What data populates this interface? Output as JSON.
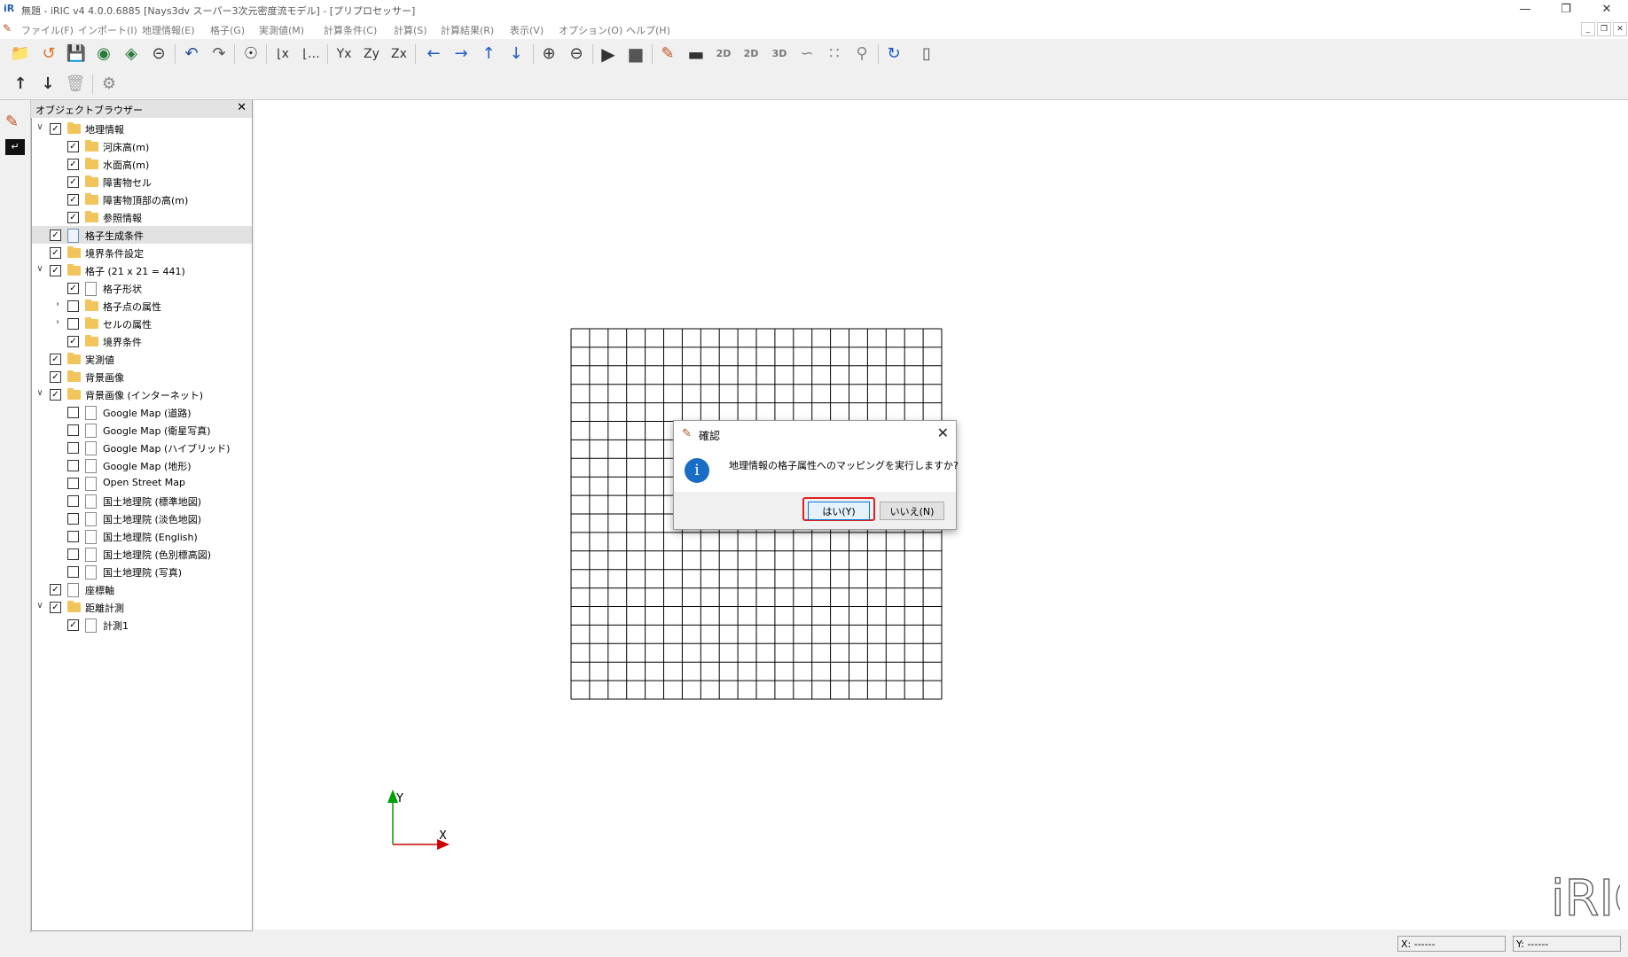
{
  "window": {
    "title": "無題 - iRIC v4 4.0.0.6885 [Nays3dv スーパー3次元密度流モデル] - [プリプロセッサー]",
    "app_icon": "iR",
    "controls": [
      "minimize-icon",
      "restore-icon",
      "close-icon"
    ]
  },
  "menu": {
    "items": [
      "ファイル(F)",
      "インポート(I)",
      "地理情報(E)",
      "格子(G)",
      "実測値(M)",
      "計算条件(C)",
      "計算(S)",
      "計算結果(R)",
      "表示(V)",
      "オプション(O)",
      "ヘルプ(H)"
    ]
  },
  "toolbar": {
    "icons": [
      "open-folder-icon",
      "open-project-icon",
      "save-icon",
      "snapshot-icon",
      "continuous-snapshot-icon",
      "google-earth-icon",
      "undo-icon",
      "redo-icon",
      "zoom-fit-icon",
      "axis-x-icon",
      "axis-x-alt-icon",
      "axis-y-icon",
      "axis-zy-icon",
      "axis-zx-icon",
      "left-arrow-icon",
      "right-arrow-icon",
      "up-arrow-icon",
      "down-arrow-icon",
      "zoom-in-icon",
      "zoom-out-icon",
      "run-icon",
      "stop-icon",
      "edit-icon",
      "console-icon",
      "2d-post-icon",
      "2d-bird-icon",
      "3d-post-icon",
      "graph-icon",
      "scattered-graph-icon",
      "zoom-graph-icon",
      "reload-icon",
      "mouse-icon"
    ],
    "row2_icons": [
      "move-up-icon",
      "move-down-icon",
      "delete-icon",
      "properties-icon"
    ]
  },
  "object_browser": {
    "title": "オブジェクトブラウザー",
    "items": [
      {
        "label": "地理情報",
        "level": 0,
        "expand": "open",
        "checked": true,
        "icon": "folder"
      },
      {
        "label": "河床高(m)",
        "level": 1,
        "expand": "",
        "checked": true,
        "icon": "folder"
      },
      {
        "label": "水面高(m)",
        "level": 1,
        "expand": "",
        "checked": true,
        "icon": "folder"
      },
      {
        "label": "障害物セル",
        "level": 1,
        "expand": "",
        "checked": true,
        "icon": "folder"
      },
      {
        "label": "障害物頂部の高(m)",
        "level": 1,
        "expand": "",
        "checked": true,
        "icon": "folder"
      },
      {
        "label": "参照情報",
        "level": 1,
        "expand": "",
        "checked": true,
        "icon": "folder"
      },
      {
        "label": "格子生成条件",
        "level": 0,
        "expand": "",
        "checked": true,
        "icon": "doc-blue",
        "selected": true
      },
      {
        "label": "境界条件設定",
        "level": 0,
        "expand": "",
        "checked": true,
        "icon": "folder"
      },
      {
        "label": "格子 (21 x 21 = 441)",
        "level": 0,
        "expand": "open",
        "checked": true,
        "icon": "folder"
      },
      {
        "label": "格子形状",
        "level": 1,
        "expand": "",
        "checked": true,
        "icon": "doc"
      },
      {
        "label": "格子点の属性",
        "level": 1,
        "expand": "closed",
        "checked": false,
        "icon": "folder"
      },
      {
        "label": "セルの属性",
        "level": 1,
        "expand": "closed",
        "checked": false,
        "icon": "folder"
      },
      {
        "label": "境界条件",
        "level": 1,
        "expand": "",
        "checked": true,
        "icon": "folder"
      },
      {
        "label": "実測値",
        "level": 0,
        "expand": "",
        "checked": true,
        "icon": "folder"
      },
      {
        "label": "背景画像",
        "level": 0,
        "expand": "",
        "checked": true,
        "icon": "folder"
      },
      {
        "label": "背景画像 (インターネット)",
        "level": 0,
        "expand": "open",
        "checked": true,
        "icon": "folder"
      },
      {
        "label": "Google Map (道路)",
        "level": 1,
        "expand": "",
        "checked": false,
        "icon": "doc"
      },
      {
        "label": "Google Map (衛星写真)",
        "level": 1,
        "expand": "",
        "checked": false,
        "icon": "doc"
      },
      {
        "label": "Google Map (ハイブリッド)",
        "level": 1,
        "expand": "",
        "checked": false,
        "icon": "doc"
      },
      {
        "label": "Google Map (地形)",
        "level": 1,
        "expand": "",
        "checked": false,
        "icon": "doc"
      },
      {
        "label": "Open Street Map",
        "level": 1,
        "expand": "",
        "checked": false,
        "icon": "doc"
      },
      {
        "label": "国土地理院 (標準地図)",
        "level": 1,
        "expand": "",
        "checked": false,
        "icon": "doc"
      },
      {
        "label": "国土地理院 (淡色地図)",
        "level": 1,
        "expand": "",
        "checked": false,
        "icon": "doc"
      },
      {
        "label": "国土地理院 (English)",
        "level": 1,
        "expand": "",
        "checked": false,
        "icon": "doc"
      },
      {
        "label": "国土地理院 (色別標高図)",
        "level": 1,
        "expand": "",
        "checked": false,
        "icon": "doc"
      },
      {
        "label": "国土地理院 (写真)",
        "level": 1,
        "expand": "",
        "checked": false,
        "icon": "doc"
      },
      {
        "label": "座標軸",
        "level": 0,
        "expand": "",
        "checked": true,
        "icon": "doc"
      },
      {
        "label": "距離計測",
        "level": 0,
        "expand": "open",
        "checked": true,
        "icon": "folder"
      },
      {
        "label": "計測1",
        "level": 1,
        "expand": "",
        "checked": true,
        "icon": "doc"
      }
    ]
  },
  "canvas": {
    "grid_cols": 20,
    "grid_rows": 20,
    "axis_x_label": "X",
    "axis_y_label": "Y",
    "logo": "iRIC",
    "colors": {
      "axis_x": "#d00000",
      "axis_y": "#00a000",
      "grid": "#000000"
    }
  },
  "dialog": {
    "title": "確認",
    "message": "地理情報の格子属性へのマッピングを実行しますか?",
    "yes_label": "はい(Y)",
    "no_label": "いいえ(N)",
    "highlight_color": "#e02020"
  },
  "status": {
    "x": "X: ------",
    "y": "Y: ------"
  }
}
